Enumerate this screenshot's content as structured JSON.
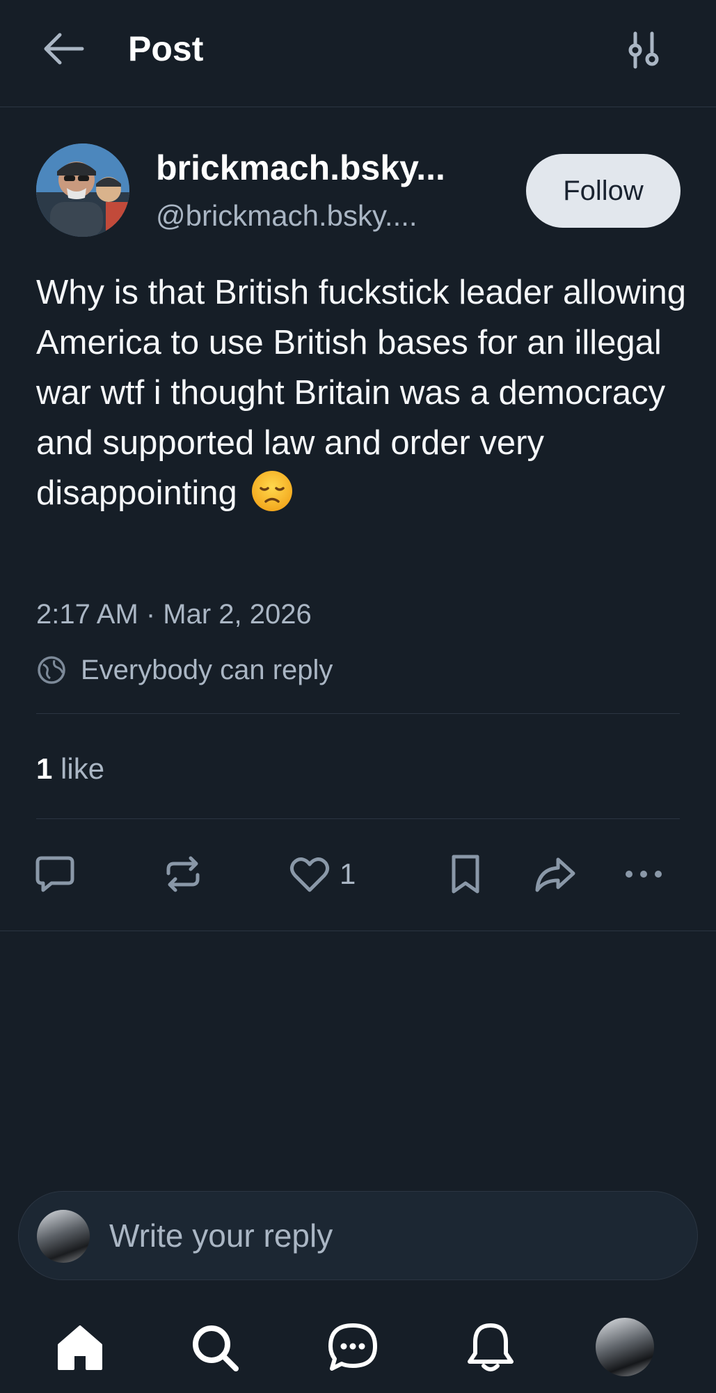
{
  "header": {
    "title": "Post",
    "back_icon": "arrow-left-icon",
    "filter_icon": "sliders-icon"
  },
  "post": {
    "author": {
      "display_name": "brickmach.bsky...",
      "handle": "@brickmach.bsky...."
    },
    "follow_label": "Follow",
    "text": "Why is that British fuckstick leader allowing America to use British bases for an illegal war wtf i thought Britain was a democracy and supported law and order very disappointing",
    "emoji": "disappointed-face-emoji",
    "timestamp": "2:17 AM · Mar 2, 2026",
    "reply_setting": "Everybody can reply",
    "likes_count": "1",
    "likes_label": "like"
  },
  "actions": {
    "reply_icon": "comment-icon",
    "repost_icon": "repost-icon",
    "like_icon": "heart-icon",
    "like_count": "1",
    "bookmark_icon": "bookmark-icon",
    "share_icon": "share-icon",
    "more_icon": "more-icon"
  },
  "composer": {
    "placeholder": "Write your reply"
  },
  "bottom_nav": {
    "items": [
      "home-icon",
      "search-icon",
      "chat-icon",
      "bell-icon",
      "profile-avatar"
    ]
  },
  "colors": {
    "background": "#161e27",
    "text_primary": "#ffffff",
    "text_secondary": "#aab6c4",
    "divider": "#2b3542",
    "follow_bg": "#e2e7ed"
  }
}
